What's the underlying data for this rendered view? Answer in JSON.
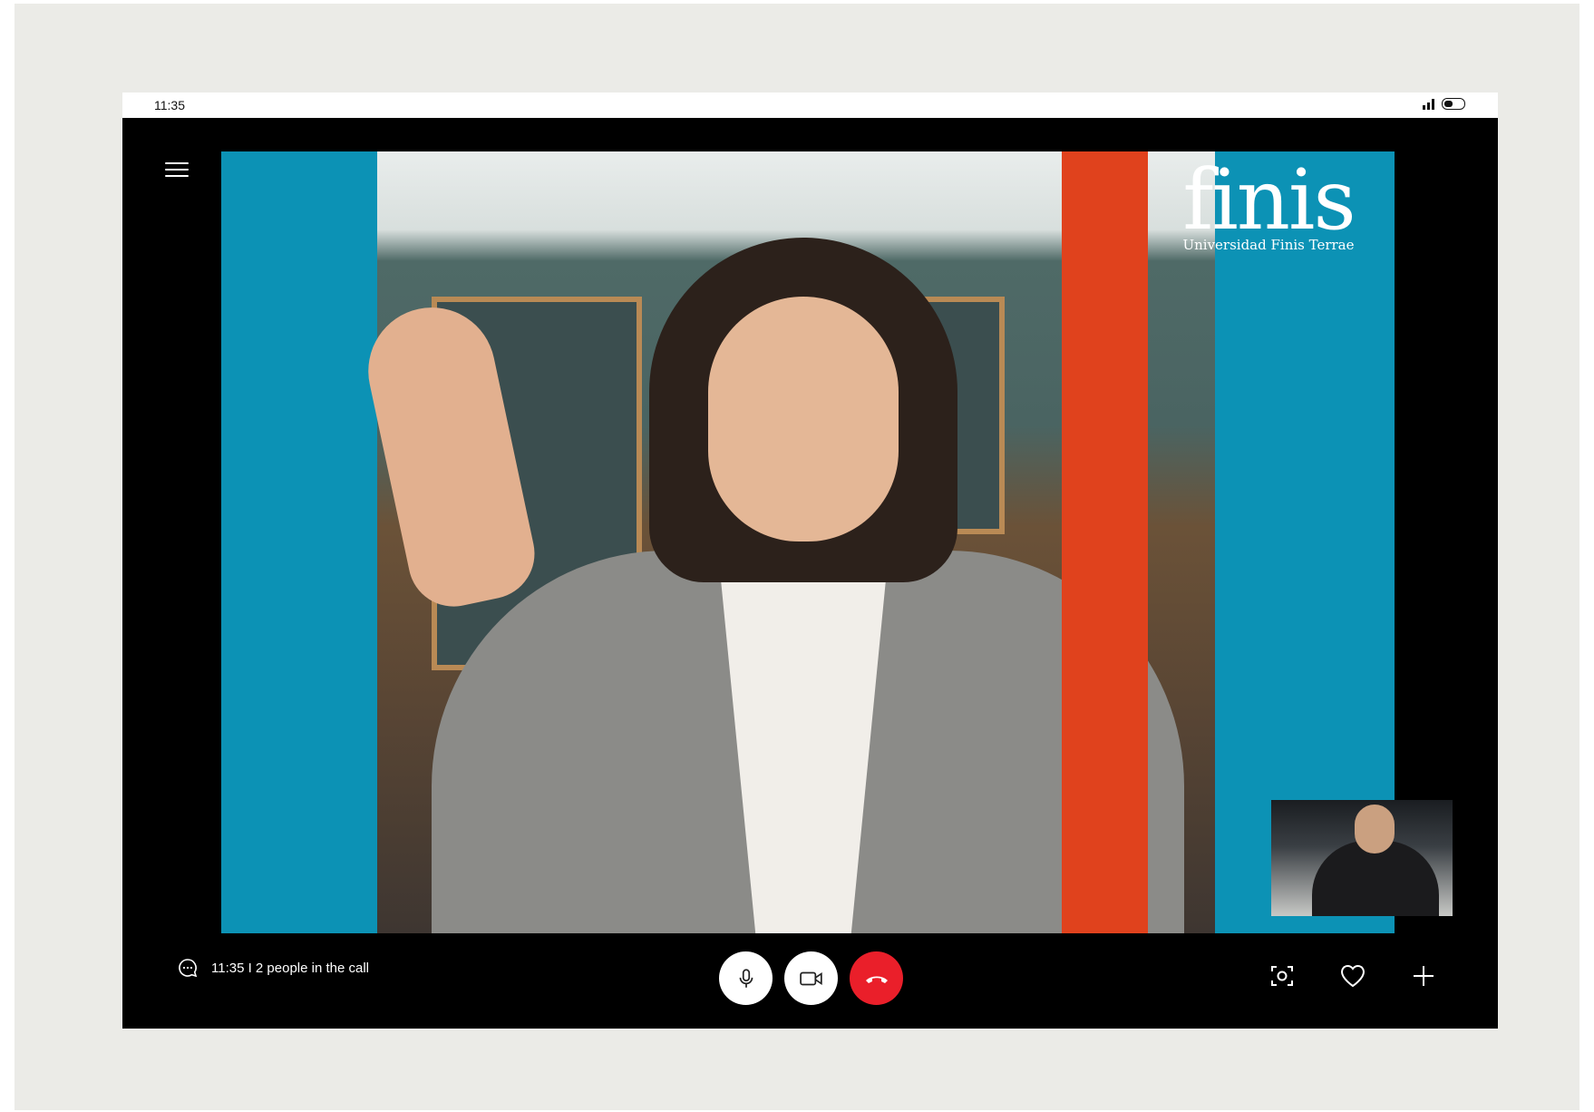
{
  "status_bar": {
    "time": "11:35",
    "icons": [
      "signal-icon",
      "battery-icon"
    ]
  },
  "brand": {
    "wordmark": "finis",
    "subtitle": "Universidad Finis Terrae"
  },
  "call": {
    "info": "11:35 I 2 people in the call",
    "participants_visible": 2
  },
  "controls": {
    "left": [
      "menu-icon",
      "chat-icon"
    ],
    "center": [
      "microphone-icon",
      "video-camera-icon",
      "hang-up-icon"
    ],
    "right": [
      "screenshot-icon",
      "heart-icon",
      "plus-icon"
    ]
  },
  "colors": {
    "background": "#ebebe7",
    "frame": "#000000",
    "brand_blue": "#0c92b5",
    "brand_red": "#e0421d",
    "hangup_red": "#ea1f2a"
  }
}
